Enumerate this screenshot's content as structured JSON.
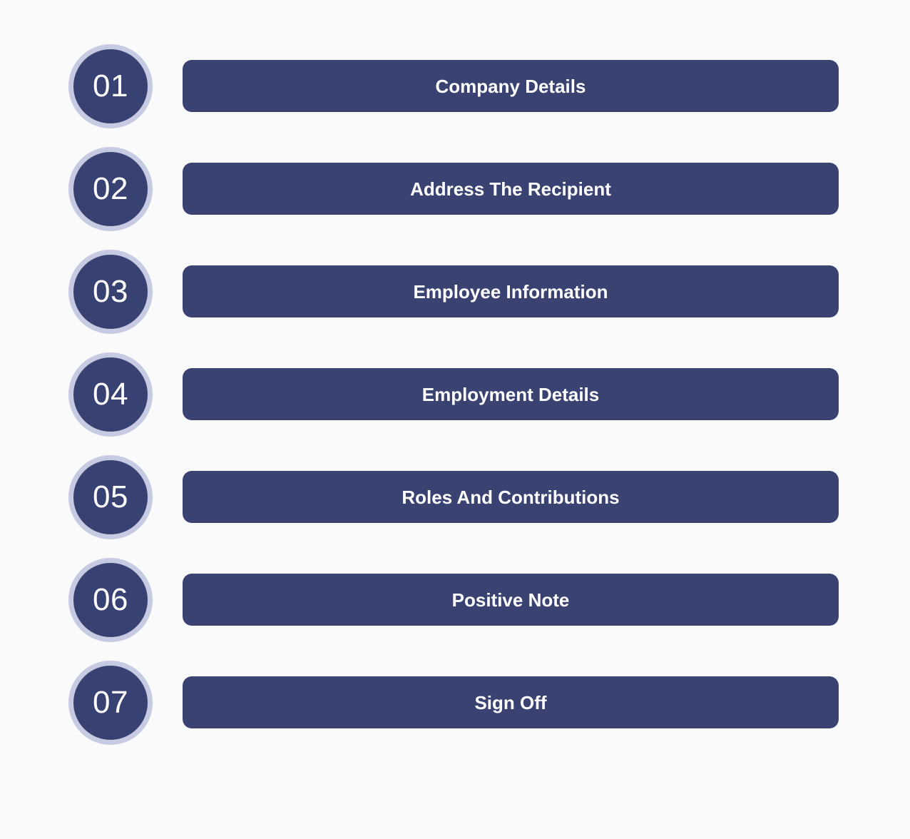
{
  "theme": {
    "background_color": "#fbfafa",
    "bar_color": "#3a4272",
    "badge_fill_color": "#384272",
    "badge_ring_color": "#c6cae2",
    "text_color": "#ffffff"
  },
  "steps": [
    {
      "number": "01",
      "label": "Company Details"
    },
    {
      "number": "02",
      "label": "Address The Recipient"
    },
    {
      "number": "03",
      "label": "Employee Information"
    },
    {
      "number": "04",
      "label": "Employment Details"
    },
    {
      "number": "05",
      "label": "Roles And Contributions"
    },
    {
      "number": "06",
      "label": "Positive Note"
    },
    {
      "number": "07",
      "label": "Sign Off"
    }
  ]
}
